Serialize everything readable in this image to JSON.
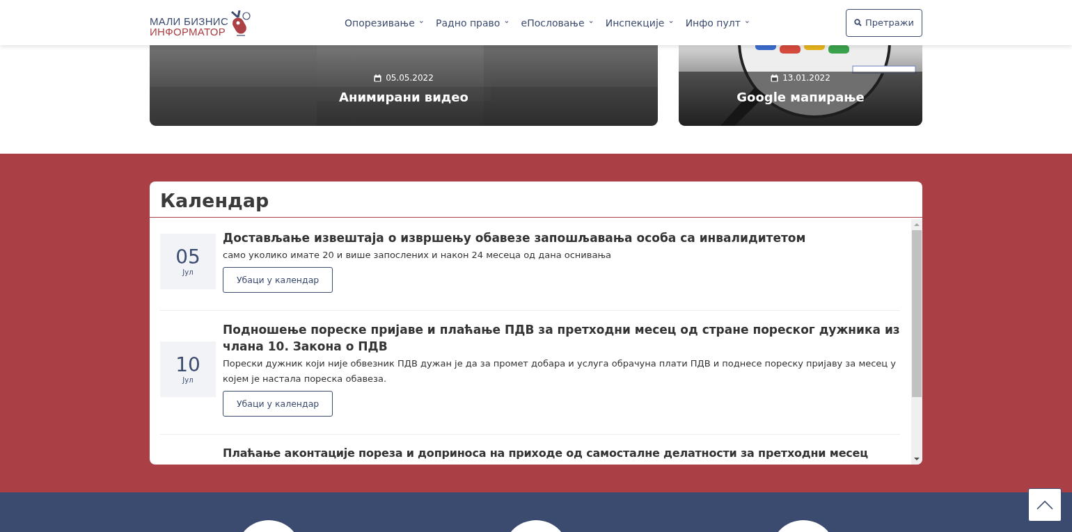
{
  "header": {
    "logo": {
      "line_1": "МАЛИ БИЗНИС",
      "line_2": "ИНФОРМАТОР"
    },
    "nav": [
      {
        "label": "Опорезивање",
        "caret": "⌄"
      },
      {
        "label": "Радно право",
        "caret": "⌄"
      },
      {
        "label": "еПословање",
        "caret": "⌄"
      },
      {
        "label": "Инспекције",
        "caret": "⌄"
      },
      {
        "label": "Инфо пулт",
        "caret": "⌄"
      }
    ],
    "search_button": "Претражи"
  },
  "cards": [
    {
      "date": "05.05.2022",
      "title": "Анимирани видео",
      "kind": "picture"
    },
    {
      "date": "13.01.2022",
      "title": "Google мапирање",
      "kind": "picture"
    }
  ],
  "calendar": {
    "title": "Календар",
    "items": [
      {
        "day": "05",
        "month": "Јул",
        "title": "Достављање извештаја о извршењу обавезе запошљавања особа са инвалидитетом",
        "description": "само уколико имате 20 и више запослених и након 24 месеца од дана оснивања",
        "button": "Убаци у календар"
      },
      {
        "day": "10",
        "month": "Јул",
        "title": "Подношење пореске пријаве и плаћање ПДВ за претходни месец од стране пореског дужника из члана 10. Закона о ПДВ",
        "description": "Порески дужник који није обвезник ПДВ дужан је да за промет добара и услуга обрачуна плати ПДВ и поднесе пореску пријаву за месец у којем је настала пореска обавеза.",
        "button": "Убаци у календар"
      },
      {
        "title": "Плаћање аконтације пореза и доприноса на приходе од самосталне делатности за претходни месец"
      }
    ]
  }
}
